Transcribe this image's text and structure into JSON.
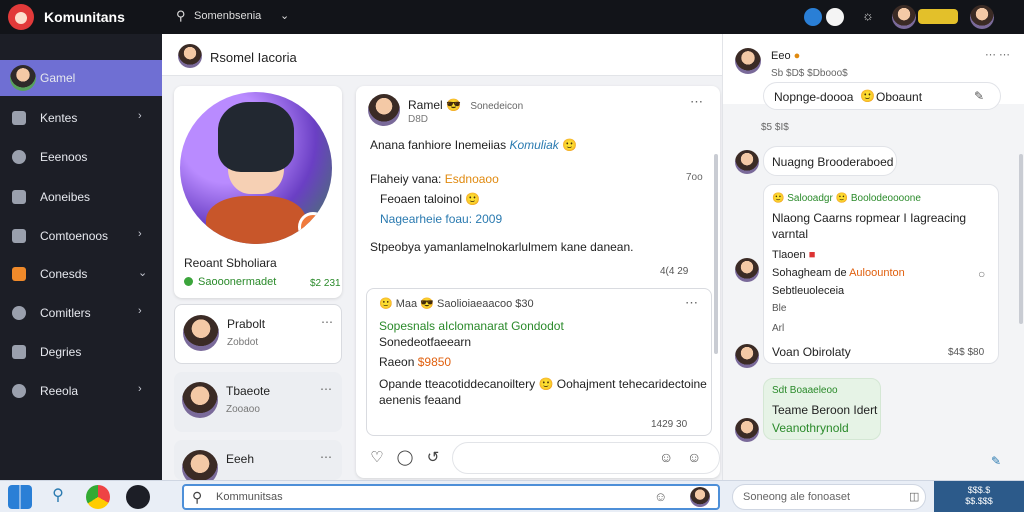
{
  "app": {
    "title": "Komunitans"
  },
  "topbar": {
    "search_text": "Somenbsenia",
    "coin_badge": ""
  },
  "sidebar": {
    "items": [
      {
        "label": "Gamel",
        "active": true
      },
      {
        "label": "Kentes",
        "chevron": true
      },
      {
        "label": "Eeenoos"
      },
      {
        "label": "Aoneibes"
      },
      {
        "label": "Comtoenoos",
        "chevron": true
      },
      {
        "label": "Conesds",
        "chevron": true
      },
      {
        "label": "Comitlers",
        "chevron": true
      },
      {
        "label": "Degries"
      },
      {
        "label": "Reeola",
        "chevron": true
      }
    ]
  },
  "middle": {
    "header_title": "Rsomel Iacoria",
    "profile": {
      "name": "Reoant Sbholiara",
      "status": "Saooonermadet",
      "count": "$2 231"
    },
    "chat_list": [
      {
        "name": "Prabolt",
        "sub": "Zobdot"
      },
      {
        "name": "Tbaeote",
        "sub": "Zooaoo"
      },
      {
        "name": "Eeeh",
        "sub": ""
      }
    ]
  },
  "post": {
    "author": "Ramel",
    "meta_right": "Sonedeicon",
    "meta": "D8D",
    "text": "Anana fanhiore Inemeiias",
    "text_link": "Komuliak",
    "line1_label": "Flaheiy vana:",
    "line1_value": "Esdnoaoo",
    "line2": "Feoaen taloinol",
    "line3": "Nagearheie foau:",
    "line3_value": "2009",
    "time": "7oo",
    "body": "Stpeobya yamanlamelnokarlulmem kane danean.",
    "likes": "4(4 29"
  },
  "reply": {
    "head": "Maa",
    "head_rest": "Saolioiaeaacoo $30",
    "green": "Sopesnals aIclomanarat Gondodot",
    "line2": "Sonedeotfaeearn",
    "price_label": "Raeon",
    "price_value": "$9850",
    "body": "Opande tteacotiddecanoiltery",
    "body_rest": "Oohajment tehecaridectoine",
    "body2": "aenenis feaand",
    "likes": "1429 30"
  },
  "right": {
    "header_name": "Eeo",
    "header_sub": "Sb $D$ $Dbooo$",
    "bubble1": "Nopnge-doooa",
    "bubble1_rest": "Oboaunt",
    "time1": "$5 $I$",
    "bubble2": "Nuagng Brooderaboed",
    "card_head": "Salooadgr",
    "card_head_rest": "Boolodeoooone",
    "card_text": "Nlaong Caarns ropmear I Iagreacing",
    "card_text2": "varntal",
    "card_line3": "Tlaoen",
    "card_line4": "Sohagheam de",
    "card_line4_value": "Auloounton",
    "card_line5": "Sebtleuoleceia",
    "card_line6": "Ble",
    "card_line7": "Arl",
    "vaan": "Voan Obirolaty",
    "vaan_time": "$4$ $80",
    "green_head": "Sdt",
    "green_head_rest": "Boaaeleoo",
    "green_line1": "Teame Beroon Idert",
    "green_line2": "Veanothrynold"
  },
  "taskbar": {
    "search_text": "Kommunitsas",
    "search2_text": "Soneong ale fonoaset",
    "clock_line1": "$$$.$",
    "clock_line2": "$$.$$$"
  }
}
